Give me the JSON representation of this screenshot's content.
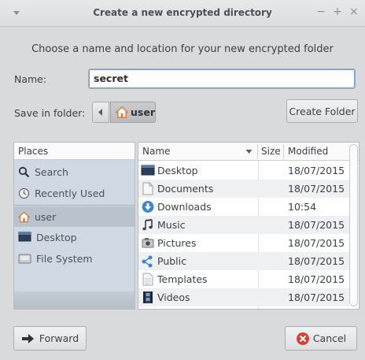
{
  "window": {
    "title": "Create a new encrypted directory",
    "controls": [
      "−",
      "+",
      "×"
    ]
  },
  "prompt": "Choose a name and location for your new encrypted folder",
  "name_field": {
    "label": "Name:",
    "value": "secret"
  },
  "save_in": {
    "label": "Save in folder:",
    "path_button": "user"
  },
  "create_folder_label": "Create Folder",
  "places": {
    "header": "Places",
    "items": [
      {
        "label": "Search",
        "icon": "search-icon"
      },
      {
        "label": "Recently Used",
        "icon": "clock-icon"
      },
      {
        "label": "user",
        "icon": "home-icon",
        "selected": true
      },
      {
        "label": "Desktop",
        "icon": "desktop-icon"
      },
      {
        "label": "File System",
        "icon": "drive-icon"
      }
    ]
  },
  "files": {
    "columns": {
      "name": "Name",
      "size": "Size",
      "modified": "Modified"
    },
    "rows": [
      {
        "name": "Desktop",
        "modified": "18/07/2015",
        "icon": "desktop-folder-icon"
      },
      {
        "name": "Documents",
        "modified": "18/07/2015",
        "icon": "documents-folder-icon"
      },
      {
        "name": "Downloads",
        "modified": "10:54",
        "icon": "downloads-folder-icon"
      },
      {
        "name": "Music",
        "modified": "18/07/2015",
        "icon": "music-folder-icon"
      },
      {
        "name": "Pictures",
        "modified": "18/07/2015",
        "icon": "pictures-folder-icon"
      },
      {
        "name": "Public",
        "modified": "18/07/2015",
        "icon": "public-folder-icon"
      },
      {
        "name": "Templates",
        "modified": "18/07/2015",
        "icon": "templates-folder-icon"
      },
      {
        "name": "Videos",
        "modified": "18/07/2015",
        "icon": "videos-folder-icon"
      }
    ]
  },
  "buttons": {
    "forward": "Forward",
    "cancel": "Cancel"
  },
  "colors": {
    "accent": "#3a87d6",
    "cancel_red": "#d9412f",
    "home_orange": "#e07b39"
  }
}
